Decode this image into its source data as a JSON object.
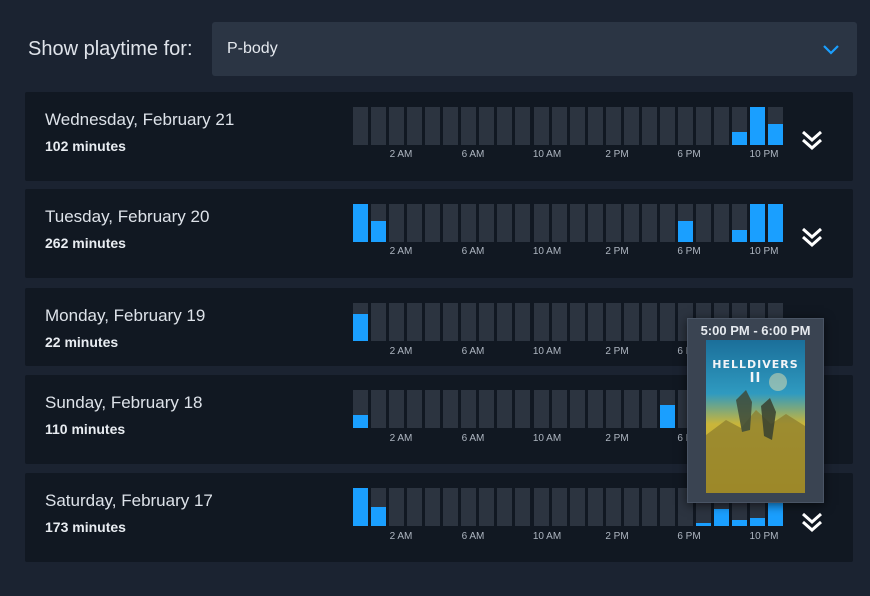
{
  "filter": {
    "label": "Show playtime for:",
    "selected": "P-body"
  },
  "days": [
    {
      "name": "Wednesday, February 21",
      "minutes": "102 minutes",
      "hours": [
        0,
        0,
        0,
        0,
        0,
        0,
        0,
        0,
        0,
        0,
        0,
        0,
        0,
        0,
        0,
        0,
        0,
        0,
        0,
        0,
        0,
        0.35,
        1.0,
        0.55
      ]
    },
    {
      "name": "Tuesday, February 20",
      "minutes": "262 minutes",
      "hours": [
        1.0,
        0.55,
        0,
        0,
        0,
        0,
        0,
        0,
        0,
        0,
        0,
        0,
        0,
        0,
        0,
        0,
        0,
        0,
        0.55,
        0,
        0,
        0.32,
        1.0,
        1.0
      ]
    },
    {
      "name": "Monday, February 19",
      "minutes": "22 minutes",
      "hours": [
        0.7,
        0,
        0,
        0,
        0,
        0,
        0,
        0,
        0,
        0,
        0,
        0,
        0,
        0,
        0,
        0,
        0,
        0,
        0,
        0,
        0,
        0,
        0,
        0
      ]
    },
    {
      "name": "Sunday, February 18",
      "minutes": "110 minutes",
      "hours": [
        0.35,
        0,
        0,
        0,
        0,
        0,
        0,
        0,
        0,
        0,
        0,
        0,
        0,
        0,
        0,
        0,
        0,
        0.6,
        0,
        0,
        0,
        0,
        0,
        0
      ]
    },
    {
      "name": "Saturday, February 17",
      "minutes": "173 minutes",
      "hours": [
        1.0,
        0.5,
        0,
        0,
        0,
        0,
        0,
        0,
        0,
        0,
        0,
        0,
        0,
        0,
        0,
        0,
        0,
        0,
        0,
        0.05,
        0.45,
        0.15,
        0.2,
        0.6
      ]
    }
  ],
  "tick_labels": [
    "2 AM",
    "6 AM",
    "10 AM",
    "2 PM",
    "6 PM",
    "10 PM"
  ],
  "tooltip": {
    "time_range": "5:00 PM - 6:00 PM",
    "game_title": "HELLDIVERS",
    "game_numeral": "II"
  },
  "colors": {
    "bar_active": "#1a9fff",
    "bar_empty": "#2c3440",
    "card_bg": "#111822",
    "page_bg": "#1b2331"
  },
  "icons": {
    "dropdown": "chevron-down-icon",
    "expand": "double-chevron-down-icon"
  }
}
